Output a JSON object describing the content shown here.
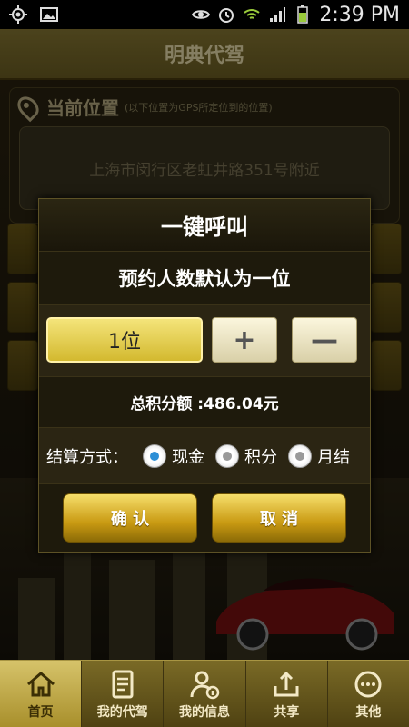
{
  "status_bar": {
    "time": "2:39 PM",
    "icons": [
      "gps-icon",
      "image-icon",
      "eye-icon",
      "alarm-icon",
      "wifi-icon",
      "signal-icon",
      "battery-icon"
    ]
  },
  "header": {
    "title": "明典代驾"
  },
  "location": {
    "title": "当前位置",
    "subtitle": "(以下位置为GPS所定位到的位置)",
    "address": "上海市闵行区老虹井路351号附近"
  },
  "dialog": {
    "title": "一键呼叫",
    "subtitle": "预约人数默认为一位",
    "count_value": "1位",
    "plus_label": "+",
    "minus_label": "—",
    "total_points": "总积分额 :486.04元",
    "payment_label": "结算方式：",
    "payment_options": [
      {
        "label": "现金",
        "selected": true
      },
      {
        "label": "积分",
        "selected": false
      },
      {
        "label": "月结",
        "selected": false
      }
    ],
    "confirm_label": "确 认",
    "cancel_label": "取 消"
  },
  "tabs": [
    {
      "label": "首页",
      "icon": "home-icon",
      "active": true
    },
    {
      "label": "我的代驾",
      "icon": "document-icon",
      "active": false
    },
    {
      "label": "我的信息",
      "icon": "user-info-icon",
      "active": false
    },
    {
      "label": "共享",
      "icon": "share-icon",
      "active": false
    },
    {
      "label": "其他",
      "icon": "more-icon",
      "active": false
    }
  ],
  "colors": {
    "accent_gold": "#d3b92f",
    "radio_selected": "#2d8fd6"
  }
}
